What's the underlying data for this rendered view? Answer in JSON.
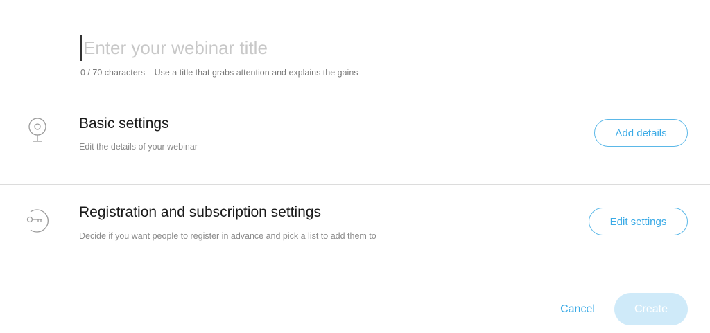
{
  "title_field": {
    "placeholder": "Enter your webinar title",
    "value": "",
    "counter": "0 / 70 characters",
    "hint": "Use a title that grabs attention and explains the gains"
  },
  "sections": [
    {
      "icon": "webcam-icon",
      "title": "Basic settings",
      "description": "Edit the details of your webinar",
      "button_label": "Add details"
    },
    {
      "icon": "key-icon",
      "title": "Registration and subscription settings",
      "description": "Decide if you want people to register in advance and pick a list to add them to",
      "button_label": "Edit settings"
    }
  ],
  "footer": {
    "cancel_label": "Cancel",
    "create_label": "Create"
  },
  "colors": {
    "accent": "#3aaae6",
    "accent_border": "#5bb8e8",
    "create_disabled_bg": "#cfeaf9",
    "divider": "#dcdcdc",
    "placeholder": "#c8c8c8"
  }
}
